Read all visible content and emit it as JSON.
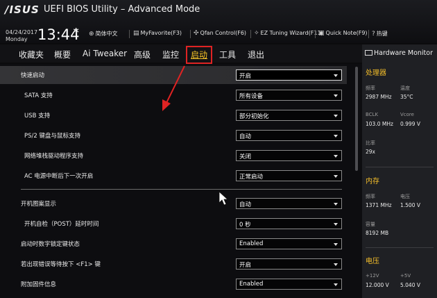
{
  "header": {
    "logo": "/ISUS",
    "title": "UEFI BIOS Utility – Advanced Mode",
    "date": "04/24/2017",
    "day": "Monday",
    "time": "13:44",
    "tools": [
      {
        "icon": "globe-icon",
        "label": "简体中文"
      },
      {
        "icon": "star-list-icon",
        "label": "MyFavorite(F3)"
      },
      {
        "icon": "fan-icon",
        "label": "Qfan Control(F6)"
      },
      {
        "icon": "tuning-icon",
        "label": "EZ Tuning Wizard(F11)"
      },
      {
        "icon": "note-icon",
        "label": "Quick Note(F9)"
      },
      {
        "icon": "hotkey-icon",
        "label": "热键"
      }
    ]
  },
  "nav": {
    "tabs": [
      "收藏夹",
      "概要",
      "Ai Tweaker",
      "高级",
      "监控",
      "启动",
      "工具",
      "退出"
    ],
    "active_index": 5,
    "active_color": "#f5c326",
    "highlight_color": "#e02323"
  },
  "settings": [
    {
      "label": "快速启动",
      "value": "开启"
    },
    {
      "label": "SATA 支持",
      "value": "所有设备"
    },
    {
      "label": "USB 支持",
      "value": "部分初始化"
    },
    {
      "label": "PS/2 键盘与鼠标支持",
      "value": "自动"
    },
    {
      "label": "网络堆栈驱动程序支持",
      "value": "关闭"
    },
    {
      "label": "AC 电源中断后下一次开启",
      "value": "正常启动"
    },
    {
      "label": "开机图案显示",
      "value": "自动"
    },
    {
      "label": "开机自检（POST）延时时间",
      "value": "0 秒"
    },
    {
      "label": "启动时数字锁定键状态",
      "value": "Enabled"
    },
    {
      "label": "若出现错误等待按下 <F1> 键",
      "value": "开启"
    },
    {
      "label": "附加固件信息",
      "value": "Enabled"
    }
  ],
  "hardware_monitor": {
    "title": "Hardware Monitor",
    "cpu": {
      "section": "处理器",
      "freq_label": "频率",
      "freq_value": "2987 MHz",
      "temp_label": "温度",
      "temp_value": "35°C",
      "bclk_label": "BCLK",
      "bclk_value": "103.0 MHz",
      "vcore_label": "Vcore",
      "vcore_value": "0.999 V",
      "ratio_label": "比率",
      "ratio_value": "29x"
    },
    "memory": {
      "section": "内存",
      "freq_label": "频率",
      "freq_value": "1371 MHz",
      "volt_label": "电压",
      "volt_value": "1.500 V",
      "cap_label": "容量",
      "cap_value": "8192 MB"
    },
    "voltage": {
      "section": "电压",
      "v12_label": "+12V",
      "v12_value": "12.000 V",
      "v5_label": "+5V",
      "v5_value": "5.040 V"
    }
  }
}
